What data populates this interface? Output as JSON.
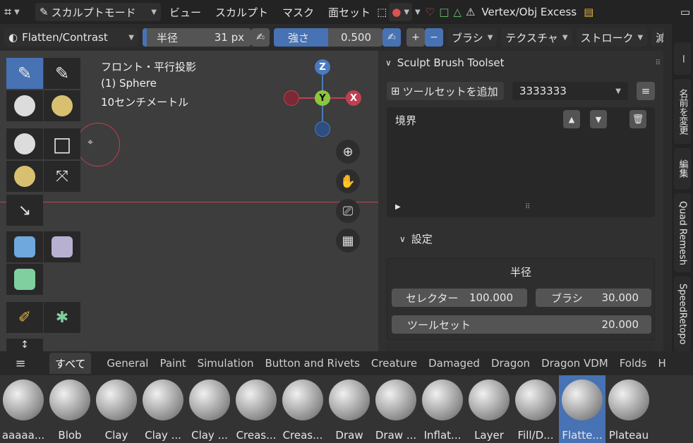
{
  "topbar": {
    "mode": "スカルプトモード",
    "menus": [
      "ビュー",
      "スカルプト",
      "マスク",
      "面セット"
    ],
    "addon": "Vertex/Obj Excess"
  },
  "toolheader": {
    "brush": "Flatten/Contrast",
    "radius_label": "半径",
    "radius_value": "31 px",
    "strength_label": "強さ",
    "strength_value": "0.500",
    "strength_fraction": 0.5,
    "plus": "+",
    "minus": "−",
    "dropdowns": [
      "ブラシ",
      "テクスチャ",
      "ストローク",
      "減"
    ]
  },
  "viewport": {
    "line1": "フロント・平行投影",
    "line2": "(1) Sphere",
    "line3": "10センチメートル",
    "gizmo": {
      "z": "Z",
      "y": "Y",
      "x": "X"
    }
  },
  "panel": {
    "title": "Sculpt Brush Toolset",
    "add_toolset": "ツールセットを追加",
    "toolset_name": "3333333",
    "list_item": "境界",
    "settings_label": "設定",
    "radius_header": "半径",
    "selector_label": "セレクター",
    "selector_value": "100.000",
    "brush_label": "ブラシ",
    "brush_value": "30.000",
    "toolset_label": "ツールセット",
    "toolset_value": "20.000"
  },
  "vtabs": [
    "ー",
    "名前を変更",
    "編集",
    "Quad Remesh",
    "SpeedRetopo"
  ],
  "shelf": {
    "tabs": [
      "すべて",
      "General",
      "Paint",
      "Simulation",
      "Button and Rivets",
      "Creature",
      "Damaged",
      "Dragon",
      "Dragon VDM",
      "Folds",
      "H"
    ],
    "brushes": [
      "aaaaa...",
      "Blob",
      "Clay",
      "Clay ...",
      "Clay ...",
      "Creas...",
      "Creas...",
      "Draw",
      "Draw ...",
      "Inflat...",
      "Layer",
      "Fill/D...",
      "Flatte...",
      "Plateau"
    ],
    "active_brush_index": 12
  }
}
